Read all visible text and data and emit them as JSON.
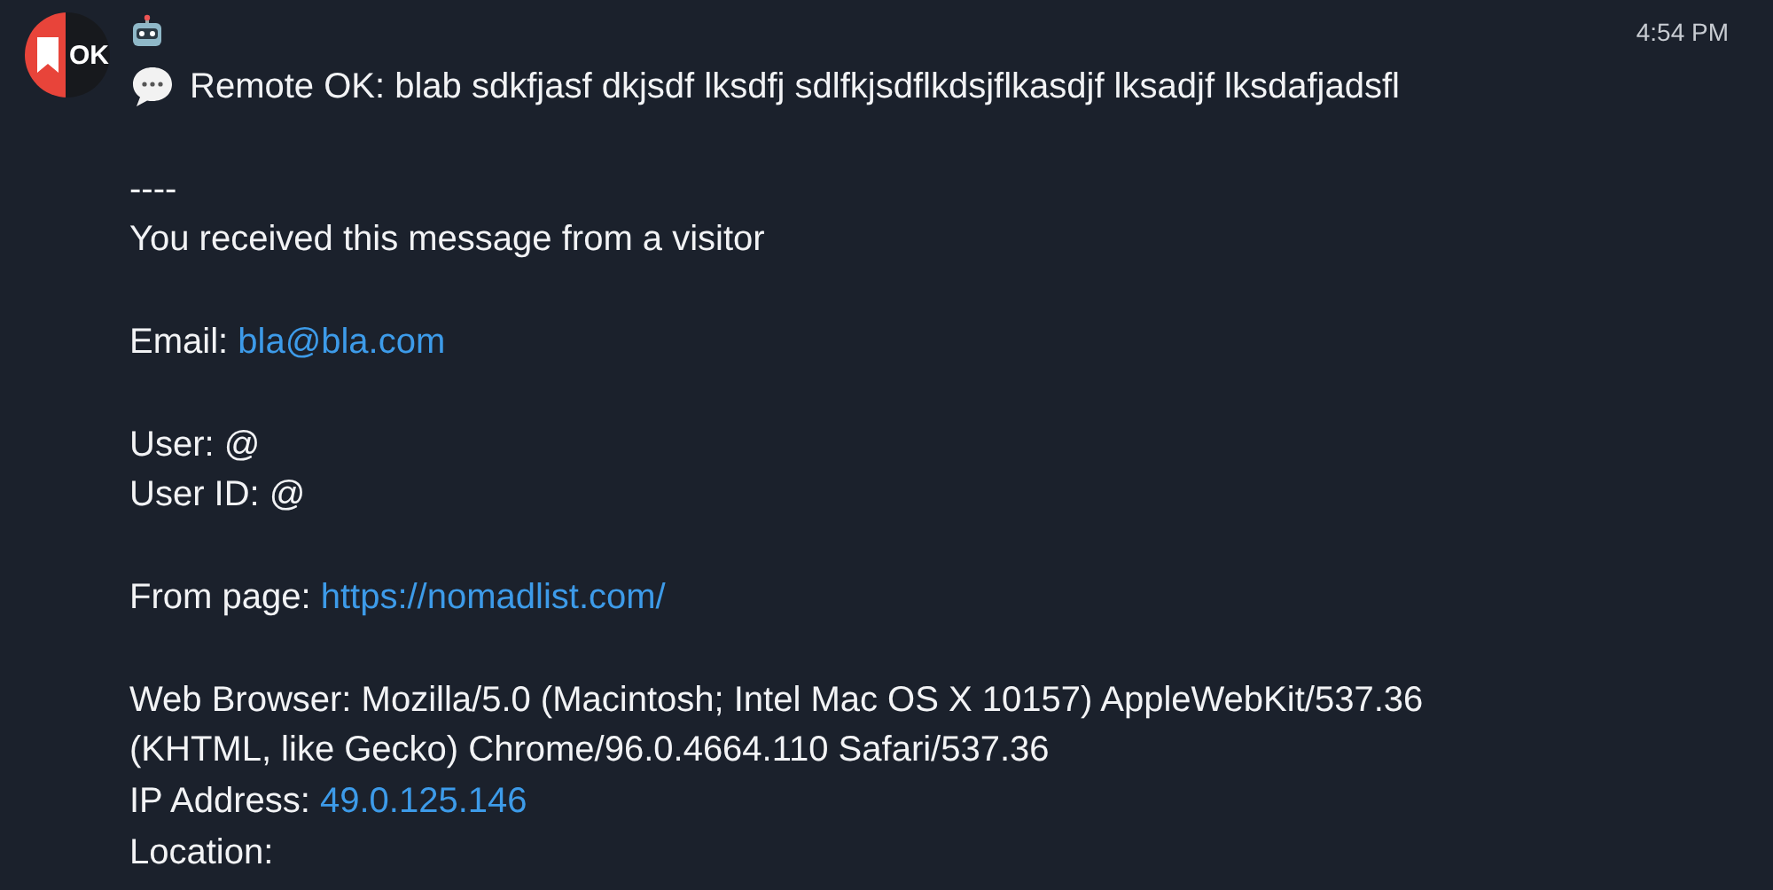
{
  "avatar": {
    "logo_text": "OK"
  },
  "time": "4:54 PM",
  "message": {
    "lines": [
      {
        "kind": "title",
        "text": "Remote OK: blab sdkfjasf dkjsdf lksdfj sdlfkjsdflkdsjflkasdjf lksadjf lksdafjadsfl"
      },
      {
        "kind": "gap"
      },
      {
        "kind": "text",
        "text": "----"
      },
      {
        "kind": "text",
        "text": "You received this message from a visitor"
      },
      {
        "kind": "gap"
      },
      {
        "kind": "field",
        "label": "Email: ",
        "link": "bla@bla.com"
      },
      {
        "kind": "gap"
      },
      {
        "kind": "text",
        "text": "User: @"
      },
      {
        "kind": "text",
        "text": "User ID: @"
      },
      {
        "kind": "gap"
      },
      {
        "kind": "field",
        "label": "From page: ",
        "link": "https://nomadlist.com/"
      },
      {
        "kind": "gap"
      },
      {
        "kind": "text",
        "text": "Web Browser: Mozilla/5.0 (Macintosh; Intel Mac OS X 10157) AppleWebKit/537.36"
      },
      {
        "kind": "text",
        "text": "(KHTML, like Gecko) Chrome/96.0.4664.110 Safari/537.36"
      },
      {
        "kind": "field",
        "label": "IP Address: ",
        "link": "49.0.125.146"
      },
      {
        "kind": "text",
        "text": "Location:"
      }
    ]
  }
}
